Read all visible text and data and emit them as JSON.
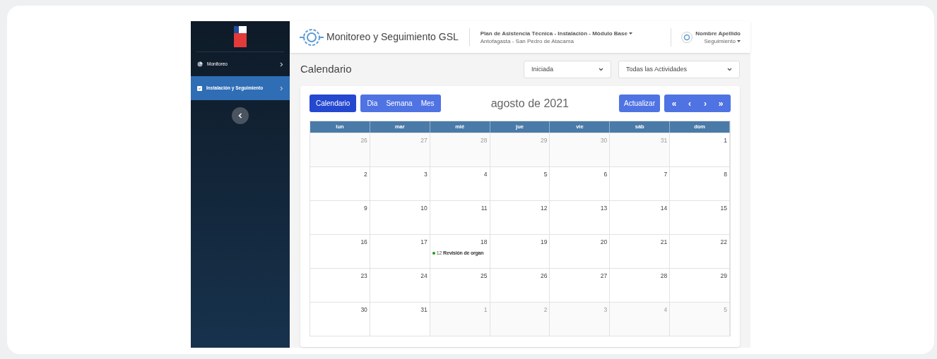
{
  "sidebar": {
    "items": [
      {
        "label": "Monitoreo",
        "selected": false,
        "kind": "chart"
      },
      {
        "label": "Instalación y Seguimiento",
        "selected": true,
        "kind": "clipboard"
      }
    ]
  },
  "header": {
    "app_title": "Monitoreo y Seguimiento GSL",
    "plan": "Plan de Asistencia Técnica - Instalación - Módulo Base",
    "location": "Antofagasta - San Pedro de Atacama",
    "user_name": "Nombre Apellido",
    "user_role": "Seguimiento"
  },
  "page_title": "Calendario",
  "filters": [
    {
      "value": "Iniciada"
    },
    {
      "value": "Todas las Actividades"
    }
  ],
  "calendar": {
    "view_buttons": [
      {
        "label": "Calendario",
        "selected": true
      },
      {
        "label": "Dia",
        "selected": false
      },
      {
        "label": "Semana",
        "selected": false
      },
      {
        "label": "Mes",
        "selected": false
      }
    ],
    "month_title": "agosto de 2021",
    "refresh_button": "Actualizar",
    "nav_buttons": [
      "«",
      "‹",
      "›",
      "»"
    ],
    "weekdays": [
      "lun",
      "mar",
      "mié",
      "jue",
      "vie",
      "sáb",
      "dom"
    ],
    "weeks": [
      [
        {
          "day": "26",
          "outside": true
        },
        {
          "day": "27",
          "outside": true
        },
        {
          "day": "28",
          "outside": true
        },
        {
          "day": "29",
          "outside": true
        },
        {
          "day": "30",
          "outside": true
        },
        {
          "day": "31",
          "outside": true
        },
        {
          "day": "1",
          "outside": false
        }
      ],
      [
        {
          "day": "2",
          "outside": false
        },
        {
          "day": "3",
          "outside": false
        },
        {
          "day": "4",
          "outside": false
        },
        {
          "day": "5",
          "outside": false
        },
        {
          "day": "6",
          "outside": false
        },
        {
          "day": "7",
          "outside": false
        },
        {
          "day": "8",
          "outside": false
        }
      ],
      [
        {
          "day": "9",
          "outside": false
        },
        {
          "day": "10",
          "outside": false
        },
        {
          "day": "11",
          "outside": false
        },
        {
          "day": "12",
          "outside": false
        },
        {
          "day": "13",
          "outside": false
        },
        {
          "day": "14",
          "outside": false
        },
        {
          "day": "15",
          "outside": false
        }
      ],
      [
        {
          "day": "16",
          "outside": false
        },
        {
          "day": "17",
          "outside": false
        },
        {
          "day": "18",
          "outside": false,
          "events": [
            {
              "time": "12",
              "title": "Revisión de organ",
              "color": "#1a9b1a"
            }
          ]
        },
        {
          "day": "19",
          "outside": false
        },
        {
          "day": "20",
          "outside": false
        },
        {
          "day": "21",
          "outside": false
        },
        {
          "day": "22",
          "outside": false
        }
      ],
      [
        {
          "day": "23",
          "outside": false
        },
        {
          "day": "24",
          "outside": false
        },
        {
          "day": "25",
          "outside": false
        },
        {
          "day": "26",
          "outside": false
        },
        {
          "day": "27",
          "outside": false
        },
        {
          "day": "28",
          "outside": false
        },
        {
          "day": "29",
          "outside": false
        }
      ],
      [
        {
          "day": "30",
          "outside": false
        },
        {
          "day": "31",
          "outside": false
        },
        {
          "day": "1",
          "outside": true
        },
        {
          "day": "2",
          "outside": true
        },
        {
          "day": "3",
          "outside": true
        },
        {
          "day": "4",
          "outside": true
        },
        {
          "day": "5",
          "outside": true
        }
      ]
    ]
  }
}
